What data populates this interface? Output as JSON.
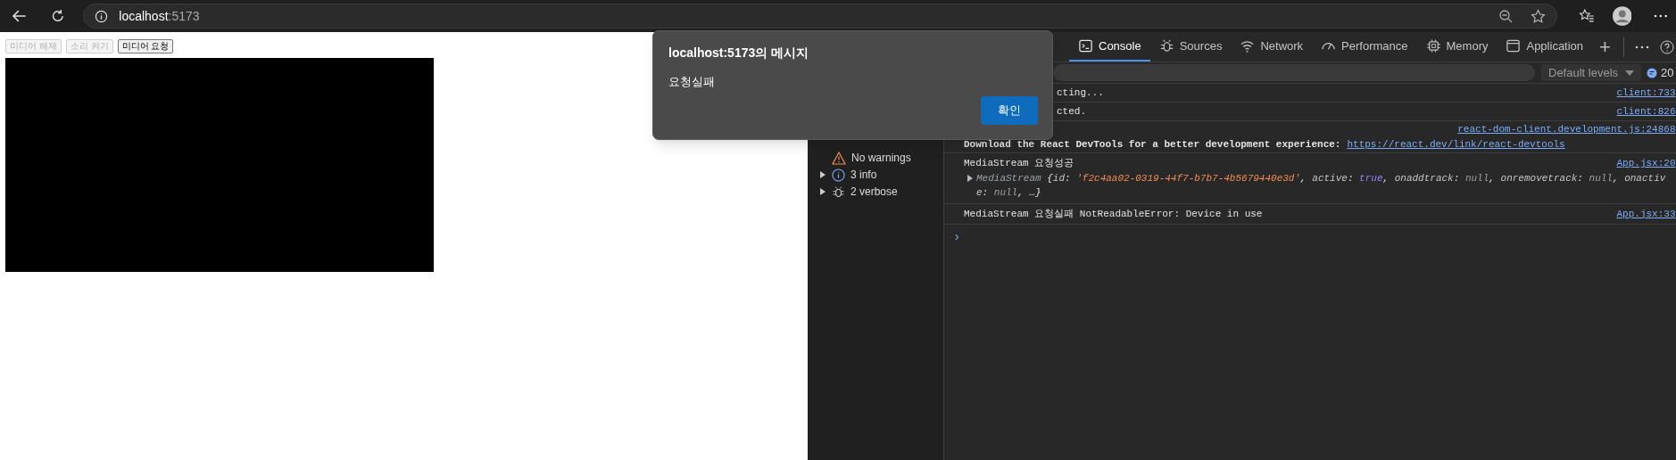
{
  "browser": {
    "host": "localhost",
    "port": ":5173"
  },
  "page": {
    "buttons": [
      {
        "label": "미디어 해제",
        "disabled": true
      },
      {
        "label": "소리 켜기",
        "disabled": true
      },
      {
        "label": "미디어 요청",
        "disabled": false
      }
    ]
  },
  "dialog": {
    "title": "localhost:5173의 메시지",
    "message": "요청실패",
    "button": "확인"
  },
  "devtools": {
    "tabs": [
      {
        "label": "Console",
        "selected": true
      },
      {
        "label": "Sources",
        "selected": false
      },
      {
        "label": "Network",
        "selected": false
      },
      {
        "label": "Performance",
        "selected": false
      },
      {
        "label": "Memory",
        "selected": false
      },
      {
        "label": "Application",
        "selected": false
      }
    ],
    "add_tab": "+",
    "levels": "Default levels",
    "issues": "20",
    "sidebar": [
      {
        "label": "No warnings",
        "kind": "warning"
      },
      {
        "label": "3 info",
        "kind": "info",
        "expanded": false
      },
      {
        "label": "2 verbose",
        "kind": "verbose",
        "expanded": false
      }
    ],
    "messages": [
      {
        "kind": "plain",
        "text": "cting...",
        "source": "client:733"
      },
      {
        "kind": "plain",
        "text": "cted.",
        "source": "client:826"
      },
      {
        "kind": "link",
        "text": "Download the React DevTools for a better development experience:",
        "link": "https://react.dev/link/react-devtools",
        "source": "react-dom-client.development.js:24868"
      },
      {
        "kind": "object",
        "text": "MediaStream 요청성공",
        "source": "App.jsx:20",
        "expanded": false,
        "lines": [
          [
            {
              "t": "MediaStream ",
              "kind": "name"
            },
            {
              "t": "{",
              "kind": "p"
            },
            {
              "t": "id",
              "kind": "k"
            },
            {
              "t": ": ",
              "kind": "p"
            },
            {
              "t": "'f2c4aa02-0319-44f7-b7b7-4b5679440e3d'",
              "kind": "s"
            },
            {
              "t": ", ",
              "kind": "p"
            },
            {
              "t": "active",
              "kind": "k"
            },
            {
              "t": ": ",
              "kind": "p"
            },
            {
              "t": "true",
              "kind": "b"
            },
            {
              "t": ", ",
              "kind": "p"
            },
            {
              "t": "onaddtrack",
              "kind": "k"
            },
            {
              "t": ": ",
              "kind": "p"
            },
            {
              "t": "null",
              "kind": "n"
            },
            {
              "t": ", ",
              "kind": "p"
            },
            {
              "t": "onremovetrack",
              "kind": "k"
            },
            {
              "t": ": ",
              "kind": "p"
            },
            {
              "t": "null",
              "kind": "n"
            },
            {
              "t": ", ",
              "kind": "p"
            },
            {
              "t": "onactiv",
              "kind": "k"
            }
          ],
          [
            {
              "t": "e",
              "kind": "k"
            },
            {
              "t": ": ",
              "kind": "p"
            },
            {
              "t": "null",
              "kind": "n"
            },
            {
              "t": ", …}",
              "kind": "p"
            }
          ]
        ]
      },
      {
        "kind": "plain",
        "text": "MediaStream 요청실패 NotReadableError: Device in use",
        "source": "App.jsx:33"
      }
    ],
    "prompt": "›"
  }
}
